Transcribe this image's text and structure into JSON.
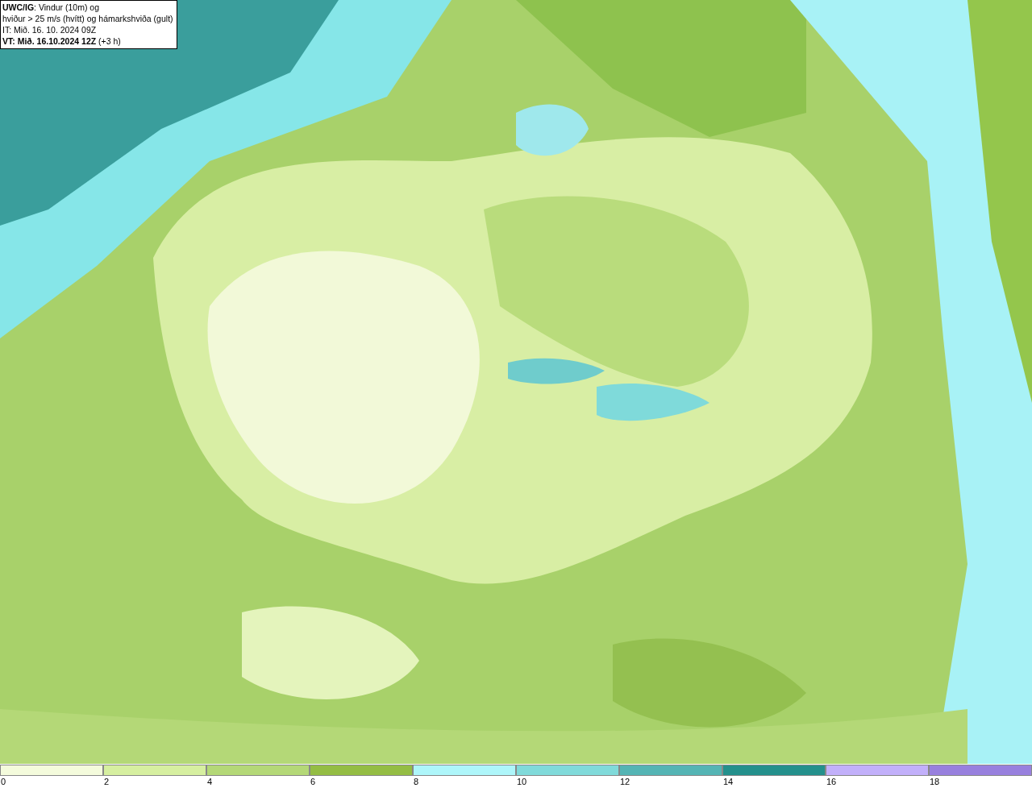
{
  "caption": {
    "lines": [
      "**UWC/IG**: Vindur (10m) og",
      "hviður > 25 m/s (hvítt) og hámarkshviða (gult)",
      "IT: Mið. 16. 10. 2024 09Z",
      "**VT: Mið. 16.10.2024 12Z** (+3 h)"
    ]
  },
  "legend": {
    "bins": [
      {
        "color": "#f4fbdc"
      },
      {
        "color": "#d6efa0"
      },
      {
        "color": "#b4d877"
      },
      {
        "color": "#94bd44"
      },
      {
        "color": "#aef6fa"
      },
      {
        "color": "#80dada"
      },
      {
        "color": "#54b4b4"
      },
      {
        "color": "#24908c"
      },
      {
        "color": "#c2b0fa"
      },
      {
        "color": "#9880de"
      }
    ],
    "labels": [
      "0",
      "2",
      "4",
      "6",
      "8",
      "10",
      "12",
      "14",
      "16",
      "18"
    ]
  }
}
